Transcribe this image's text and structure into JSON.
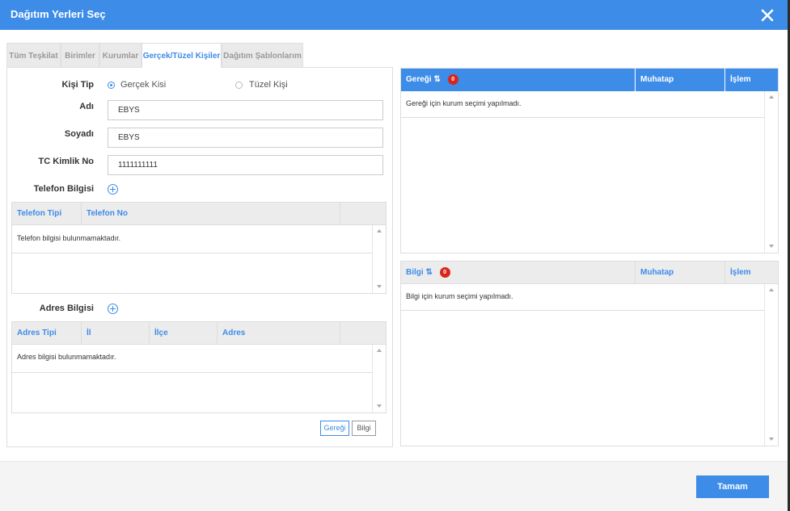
{
  "dialog": {
    "title": "Dağıtım Yerleri Seç"
  },
  "tabs": [
    {
      "label": "Tüm Teşkilat"
    },
    {
      "label": "Birimler"
    },
    {
      "label": "Kurumlar"
    },
    {
      "label": "Gerçek/Tüzel Kişiler"
    },
    {
      "label": "Dağıtım Şablonlarım"
    }
  ],
  "form": {
    "kisi_tip_label": "Kişi Tip",
    "gercek_label": "Gerçek Kisi",
    "tuzel_label": "Tüzel Kişi",
    "selected": "Gerçek Kisi",
    "adi_label": "Adı",
    "adi_value": "EBYS",
    "soyadi_label": "Soyadı",
    "soyadi_value": "EBYS",
    "tc_label": "TC Kimlik No",
    "tc_value": "1111111111",
    "telefon_label": "Telefon Bilgisi",
    "adres_label": "Adres Bilgisi"
  },
  "telefon_table": {
    "columns": [
      "Telefon Tipi",
      "Telefon No"
    ],
    "empty_message": "Telefon bilgisi bulunmamaktadır."
  },
  "adres_table": {
    "columns": [
      "Adres Tipi",
      "İl",
      "İlçe",
      "Adres"
    ],
    "empty_message": "Adres bilgisi bulunmamaktadır."
  },
  "actions": {
    "geregi_button": "Gereği",
    "bilgi_button": "Bilgi"
  },
  "geregi_panel": {
    "title": "Gereği",
    "count": "0",
    "col_muhatap": "Muhatap",
    "col_islem": "İşlem",
    "empty_message": "Gereği için kurum seçimi yapılmadı."
  },
  "bilgi_panel": {
    "title": "Bilgi",
    "count": "0",
    "col_muhatap": "Muhatap",
    "col_islem": "İşlem",
    "empty_message": "Bilgi için kurum seçimi yapılmadı."
  },
  "footer": {
    "ok_button": "Tamam"
  },
  "colors": {
    "accent": "#3d8ce8",
    "badge": "#d9261c"
  }
}
